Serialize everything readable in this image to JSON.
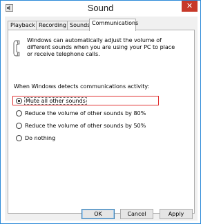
{
  "window": {
    "title": "Sound",
    "close_glyph": "✕"
  },
  "tabs": [
    {
      "label": "Playback"
    },
    {
      "label": "Recording"
    },
    {
      "label": "Sounds"
    },
    {
      "label": "Communications"
    }
  ],
  "panel": {
    "info_text": "Windows can automatically adjust the volume of different sounds when you are using your PC to place or receive telephone calls.",
    "section_label": "When Windows detects communications activity:",
    "options": [
      {
        "label": "Mute all other sounds",
        "checked": true
      },
      {
        "label": "Reduce the volume of other sounds by 80%",
        "checked": false
      },
      {
        "label": "Reduce the volume of other sounds by 50%",
        "checked": false
      },
      {
        "label": "Do nothing",
        "checked": false
      }
    ]
  },
  "buttons": {
    "ok": "OK",
    "cancel": "Cancel",
    "apply": "Apply"
  },
  "colors": {
    "window_border": "#2b8ad8",
    "close_button": "#c7392a",
    "highlight": "#e03030"
  },
  "icons": {
    "app": "speaker-icon",
    "info": "telephone-handset-icon",
    "close": "close-icon"
  }
}
